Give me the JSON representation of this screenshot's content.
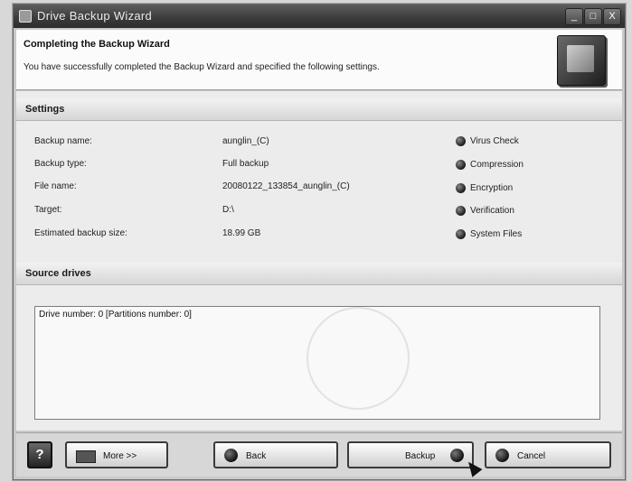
{
  "window": {
    "title": "Drive Backup Wizard",
    "controls": {
      "minimize": "_",
      "maximize": "□",
      "close": "X"
    }
  },
  "header": {
    "title": "Completing the Backup Wizard",
    "subtitle": "You have successfully completed the Backup Wizard and specified the following settings."
  },
  "settings": {
    "heading": "Settings",
    "rows": [
      {
        "label": "Backup name:",
        "value": "aunglin_(C)"
      },
      {
        "label": "Backup type:",
        "value": "Full backup"
      },
      {
        "label": "File name:",
        "value": "20080122_133854_aunglin_(C)"
      },
      {
        "label": "Target:",
        "value": "D:\\"
      },
      {
        "label": "Estimated backup size:",
        "value": "18.99 GB"
      }
    ],
    "options": [
      {
        "label": "Virus Check",
        "icon": "bullet-icon"
      },
      {
        "label": "Compression",
        "icon": "bullet-icon"
      },
      {
        "label": "Encryption",
        "icon": "bullet-icon"
      },
      {
        "label": "Verification",
        "icon": "bullet-icon"
      },
      {
        "label": "System Files",
        "icon": "bullet-icon"
      }
    ]
  },
  "source_drives": {
    "heading": "Source drives",
    "line": "Drive number: 0 [Partitions number: 0]"
  },
  "footer": {
    "help": "?",
    "more": "More >>",
    "back": "Back",
    "backup": "Backup",
    "cancel": "Cancel"
  }
}
